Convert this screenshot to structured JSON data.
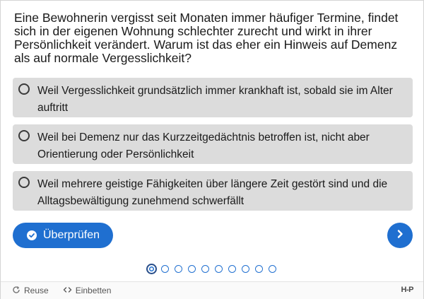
{
  "question": {
    "text": "Eine Bewohnerin vergisst seit Monaten immer häufiger Termine, findet sich in der eigenen Wohnung schlechter zurecht und wirkt in ihrer Persönlichkeit verändert. Warum ist das eher ein Hinweis auf Demenz als auf normale Vergesslichkeit?"
  },
  "answers": [
    {
      "label": "Weil Vergesslichkeit grundsätzlich immer krankhaft ist, sobald sie im Alter auftritt",
      "selected": false
    },
    {
      "label": "Weil bei Demenz nur das Kurzzeitgedächtnis betroffen ist, nicht aber Orientierung oder Persönlichkeit",
      "selected": false
    },
    {
      "label": "Weil mehrere geistige Fähigkeiten über längere Zeit gestört sind und die Alltagsbewältigung zunehmend schwerfällt",
      "selected": false
    }
  ],
  "actions": {
    "check_label": "Überprüfen",
    "check_icon": "check-circle-icon",
    "next_icon": "chevron-right-icon"
  },
  "pagination": {
    "total": 10,
    "current": 1
  },
  "footer": {
    "reuse_label": "Reuse",
    "embed_label": "Einbetten",
    "logo_text": "H-P"
  },
  "colors": {
    "accent": "#1f6fd0",
    "answer_bg": "#dcdcdc",
    "footer_bg": "#fafafa"
  }
}
